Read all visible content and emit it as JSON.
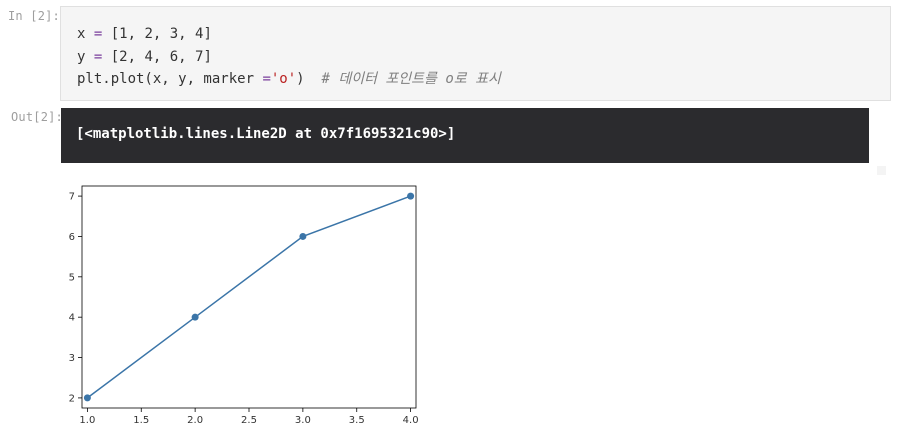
{
  "cell": {
    "in_prompt": "In [2]:",
    "out_prompt": "Out[2]:",
    "code_lines": [
      {
        "var": "x",
        "op": "=",
        "rest": "[1, 2, 3, 4]"
      },
      {
        "var": "y",
        "op": "=",
        "rest": "[2, 4, 6, 7]"
      },
      {
        "call": "plt.plot(x, y, marker ",
        "op": "=",
        "str": "'o'",
        "close": ")",
        "comment": "# 데이터 포인트를 o로 표시"
      }
    ],
    "output_text": "[<matplotlib.lines.Line2D at 0x7f1695321c90>]"
  },
  "colors": {
    "line": "#3b75a8",
    "output_bg": "#2b2b2e",
    "input_bg": "#f5f5f5"
  },
  "chart_data": {
    "type": "line",
    "x": [
      1,
      2,
      3,
      4
    ],
    "series": [
      {
        "values": [
          2,
          4,
          6,
          7
        ],
        "marker": "o"
      }
    ],
    "xlim": [
      0.95,
      4.05
    ],
    "ylim": [
      1.75,
      7.25
    ],
    "xticks": [
      1.0,
      1.5,
      2.0,
      2.5,
      3.0,
      3.5,
      4.0
    ],
    "xtick_labels": [
      "1.0",
      "1.5",
      "2.0",
      "2.5",
      "3.0",
      "3.5",
      "4.0"
    ],
    "yticks": [
      2,
      3,
      4,
      5,
      6,
      7
    ],
    "ytick_labels": [
      "2",
      "3",
      "4",
      "5",
      "6",
      "7"
    ],
    "title": "",
    "xlabel": "",
    "ylabel": "",
    "grid": false
  }
}
